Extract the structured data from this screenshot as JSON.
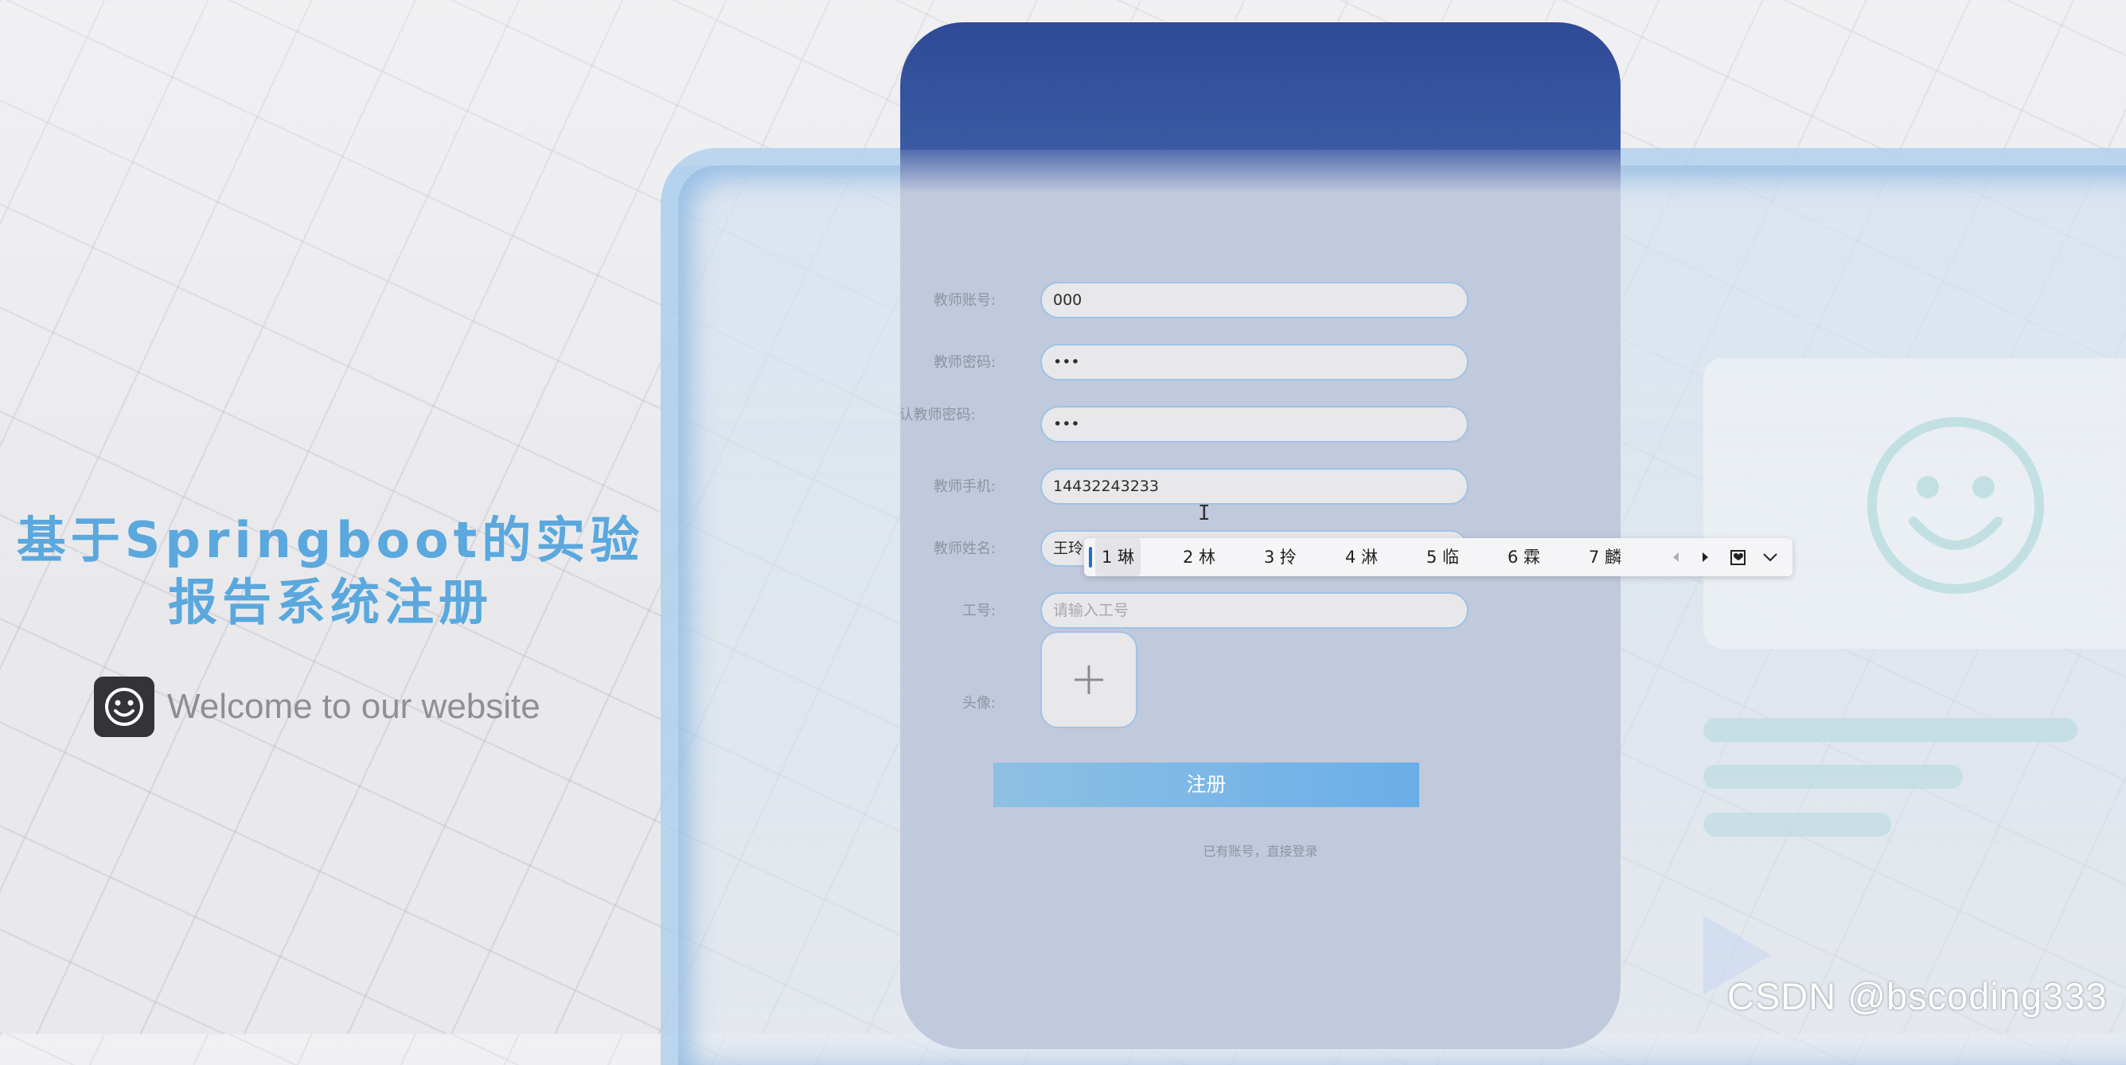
{
  "hero": {
    "title_line1": "基于Springboot的实验",
    "title_line2": "报告系统注册",
    "welcome_text": "Welcome to our website",
    "logo_icon": "smiley-face-icon"
  },
  "form": {
    "fields": [
      {
        "label": "教师账号:",
        "value": "000"
      },
      {
        "label": "教师密码:",
        "value": "•••"
      },
      {
        "label": "确认教师密码:",
        "value": "•••"
      },
      {
        "label": "教师手机:",
        "value": "14432243233"
      },
      {
        "label": "教师姓名:",
        "value": "王玲lin"
      },
      {
        "label": "工号:",
        "placeholder": "请输入工号"
      }
    ],
    "avatar_label": "头像:",
    "upload_icon": "plus-icon",
    "submit_label": "注册",
    "login_link": "已有账号，直接登录"
  },
  "ime": {
    "candidates": [
      "1 琳",
      "2 林",
      "3 拎",
      "4 淋",
      "5 临",
      "6 霖",
      "7 麟"
    ],
    "controls": [
      "prev-page-icon",
      "next-page-icon",
      "skin-icon",
      "expand-chevron-icon"
    ]
  },
  "watermark": "CSDN @bscoding333",
  "colors": {
    "card_header": "#2f4a96",
    "card_body": "#c1c9dc",
    "accent": "#5aa8dd",
    "submit": "#6aaee8"
  }
}
